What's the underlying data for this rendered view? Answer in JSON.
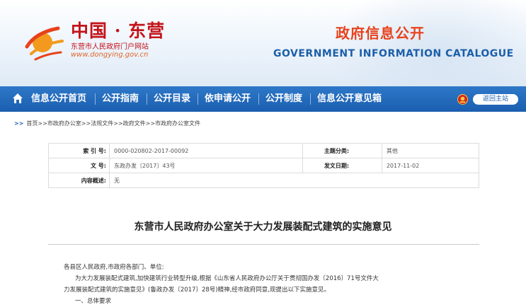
{
  "header": {
    "logo_title": "中国 · 东营",
    "logo_subtitle": "东营市人民政府门户网站",
    "logo_url": "www.dongying.gov.cn",
    "banner_cn": "政府信息公开",
    "banner_en": "GOVERNMENT INFORMATION CATALOGUE"
  },
  "nav": {
    "items": [
      "信息公开首页",
      "公开指南",
      "公开目录",
      "依申请公开",
      "公开制度",
      "信息公开意见箱"
    ],
    "return_label": "返回主站"
  },
  "breadcrumb": "首页>>市政府办公室>>法规文件>>政府文件>>市政府办公室文件",
  "meta": {
    "index_label": "索 引 号:",
    "index_value": "0000-020802-2017-00092",
    "category_label": "主题分类:",
    "category_value": "其他",
    "docno_label": "文 号:",
    "docno_value": "东政办发〔2017〕43号",
    "date_label": "发文日期:",
    "date_value": "2017-11-02",
    "summary_label": "内容概述:",
    "summary_value": "无"
  },
  "document": {
    "title": "东营市人民政府办公室关于大力发展装配式建筑的实施意见",
    "salutation": "各县区人民政府,市政府各部门、单位:",
    "para1_line1": "为大力发展装配式建筑,加快建筑行业转型升级,根据《山东省人民政府办公厅关于贯彻国办发〔2016〕71号文件大",
    "para1_line2": "力发展装配式建筑的实施意见》(鲁政办发〔2017〕28号)精神,经市政府同意,现提出以下实施意见。",
    "section1": "一、总体要求"
  },
  "colors": {
    "nav_blue": "#1b5eaf",
    "brand_red": "#c3141b",
    "banner_orange": "#e8421c",
    "banner_blue": "#1b5fa8"
  }
}
